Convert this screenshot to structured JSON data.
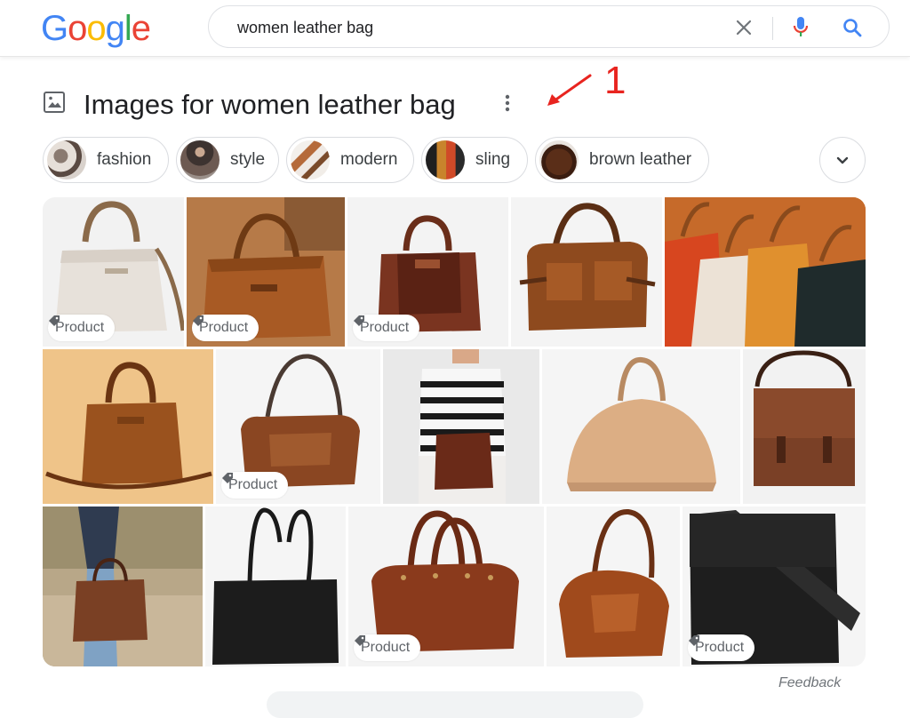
{
  "logo": {
    "letters": [
      "G",
      "o",
      "o",
      "g",
      "l",
      "e"
    ],
    "colors": [
      "#4285F4",
      "#EA4335",
      "#FBBC05",
      "#4285F4",
      "#34A853",
      "#EA4335"
    ]
  },
  "search": {
    "value": "women leather bag"
  },
  "images_section": {
    "title": "Images for women leather bag",
    "annotation": "1",
    "chips": [
      {
        "label": "fashion"
      },
      {
        "label": "style"
      },
      {
        "label": "modern"
      },
      {
        "label": "sling"
      },
      {
        "label": "brown leather"
      }
    ],
    "badge_label": "Product",
    "rows": [
      [
        {
          "name": "white-handbag",
          "badge": true
        },
        {
          "name": "tan-tote-bag",
          "badge": true
        },
        {
          "name": "brown-satchel",
          "badge": true
        },
        {
          "name": "brown-duffel-bag",
          "badge": false
        },
        {
          "name": "colorful-bags-display",
          "badge": false
        }
      ],
      [
        {
          "name": "brown-handbag-yellow-bg",
          "badge": false
        },
        {
          "name": "brown-hobo-bag",
          "badge": true
        },
        {
          "name": "woman-striped-sweater-bag",
          "badge": false
        },
        {
          "name": "beige-dome-bag",
          "badge": false
        },
        {
          "name": "brown-messenger-bag",
          "badge": false
        }
      ],
      [
        {
          "name": "woman-holding-brown-tote",
          "badge": false
        },
        {
          "name": "black-tote-bag",
          "badge": false
        },
        {
          "name": "brown-doctor-bag",
          "badge": true
        },
        {
          "name": "brown-hobo-shoulder-bag",
          "badge": false
        },
        {
          "name": "black-bucket-bag",
          "badge": true
        }
      ]
    ]
  },
  "feedback": "Feedback",
  "colors": {
    "accent_blue": "#4285F4",
    "annotation_red": "#E8241F",
    "text_primary": "#202124"
  }
}
